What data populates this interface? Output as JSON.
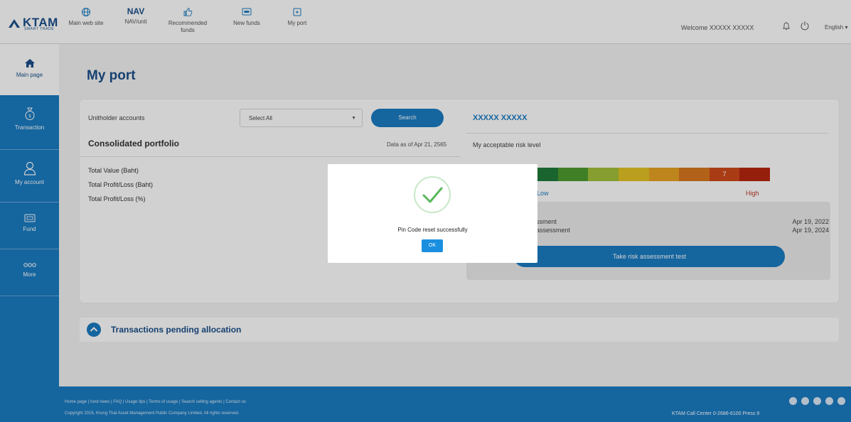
{
  "header": {
    "logo_text": "KTAM",
    "logo_sub": "SMART TRADE",
    "nav": [
      {
        "label": "Main web site",
        "icon": "globe-icon"
      },
      {
        "label_big": "NAV",
        "label": "NAV/unit"
      },
      {
        "label": "Recommended funds",
        "icon": "thumbs-up-icon"
      },
      {
        "label": "New funds",
        "icon": "new-badge-icon"
      },
      {
        "label": "My port",
        "icon": "portfolio-icon"
      }
    ],
    "welcome": "Welcome XXXXX XXXXX",
    "language": "English ▾"
  },
  "sidebar": {
    "items": [
      {
        "label": "Main page",
        "icon": "home-icon"
      },
      {
        "label": "Transaction",
        "icon": "money-bag-icon"
      },
      {
        "label": "My account",
        "icon": "user-icon"
      },
      {
        "label": "Fund",
        "icon": "fund-icon"
      },
      {
        "label": "More",
        "icon": "more-dots-icon"
      }
    ]
  },
  "main": {
    "title": "My port",
    "unitholder_label": "Unitholder accounts",
    "select_value": "Select All",
    "search_label": "Search",
    "consolidated": "Consolidated portfolio",
    "as_of": "Data as of Apr 21, 2565",
    "rows": [
      "Total Value (Baht)",
      "Total Profit/Loss (Baht)",
      "Total Profit/Loss (%)"
    ],
    "user_name": "XXXXX XXXXX",
    "risk_title": "My acceptable risk level",
    "risk_level": 7,
    "risk_low": "Low",
    "risk_high": "High",
    "assess_1_label": "ssment",
    "assess_1_date": "Apr 19, 2022",
    "assess_2_label": "assessment",
    "assess_2_date": "Apr 19, 2024",
    "risk_button": "Take risk assessment test",
    "pending": "Transactions pending allocation"
  },
  "footer": {
    "links": "Home page | fund news | FAQ | Usage tips | Terms of usage | Search selling agents | Contact us",
    "copyright": "Copyright 2016, Krung Thai Asset Management Public Company Limited. All rights reserved.",
    "call_center": "KTAM Call Center 0-2686-6100 Press 9"
  },
  "modal": {
    "message": "Pin Code reset successfully",
    "ok": "OK"
  },
  "colors": {
    "brand": "#1a7cc2",
    "risk_segments": [
      "#1f7b3a",
      "#4f9c2f",
      "#a3c13a",
      "#e3c226",
      "#e8a323",
      "#d9781e",
      "#cf4a1a",
      "#b8260f"
    ]
  }
}
